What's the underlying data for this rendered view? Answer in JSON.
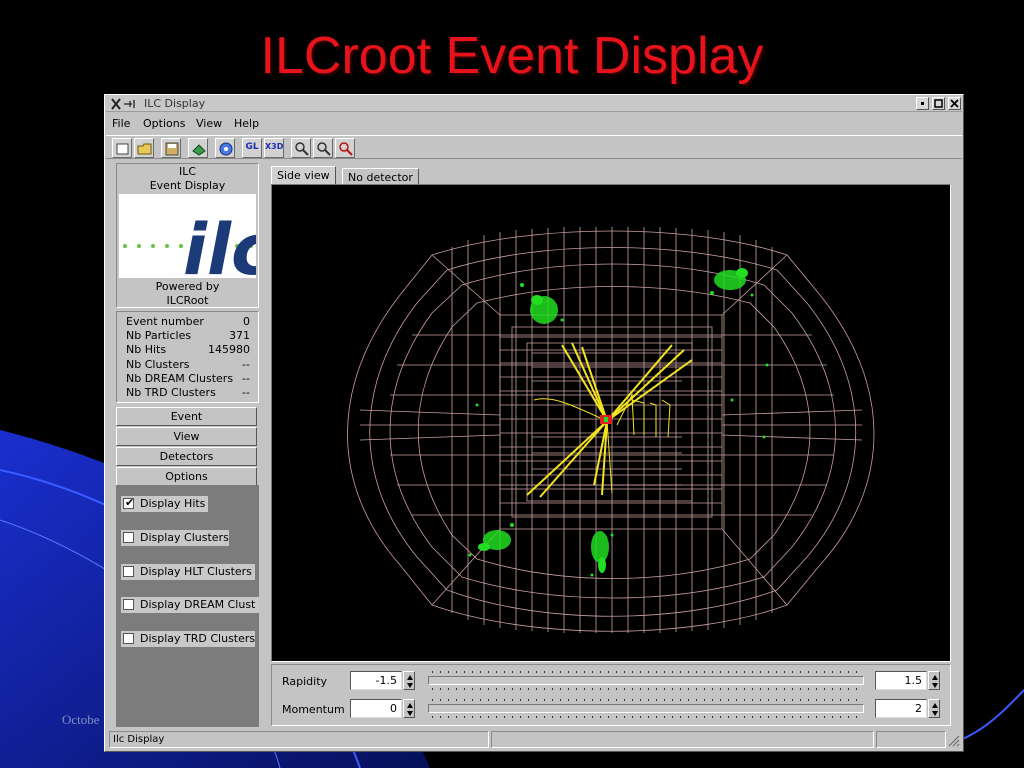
{
  "slide": {
    "title": "ILCroot Event Display",
    "footer_fragment": "Octobe"
  },
  "window": {
    "title": "ILC Display",
    "controls": [
      "minimize",
      "maximize",
      "close"
    ]
  },
  "menu": [
    "File",
    "Options",
    "View",
    "Help"
  ],
  "toolbar": {
    "buttons": [
      {
        "icon": "new-file-icon"
      },
      {
        "icon": "open-folder-icon"
      },
      {
        "icon": "save-icon"
      },
      {
        "icon": "print-icon"
      },
      {
        "icon": "info-icon"
      },
      {
        "icon": "gl-view-icon",
        "text": "GL"
      },
      {
        "icon": "x3d-view-icon",
        "text": "X3D"
      },
      {
        "icon": "zoom-in-icon"
      },
      {
        "icon": "zoom-out-icon"
      },
      {
        "icon": "zoom-reset-icon"
      }
    ]
  },
  "logo": {
    "line1": "ILC",
    "line2": "Event Display",
    "mark_text": "ilc",
    "powered_line1": "Powered by",
    "powered_line2": "ILCRoot"
  },
  "stats": [
    {
      "label": "Event number",
      "value": "0"
    },
    {
      "label": "Nb Particles",
      "value": "371"
    },
    {
      "label": "Nb Hits",
      "value": "145980"
    },
    {
      "label": "Nb Clusters",
      "value": "--"
    },
    {
      "label": "Nb DREAM Clusters",
      "value": "--"
    },
    {
      "label": "Nb TRD Clusters",
      "value": "--"
    }
  ],
  "nav_buttons": [
    "Event",
    "View",
    "Detectors",
    "Options"
  ],
  "options": [
    {
      "label": "Display Hits",
      "checked": true
    },
    {
      "label": "Display Clusters",
      "checked": false
    },
    {
      "label": "Display HLT Clusters",
      "checked": false
    },
    {
      "label": "Display DREAM Clust",
      "checked": false
    },
    {
      "label": "Display TRD Clusters",
      "checked": false
    }
  ],
  "tabs": [
    {
      "label": "Side view",
      "active": true
    },
    {
      "label": "No detector",
      "active": false
    }
  ],
  "controls": {
    "rapidity": {
      "label": "Rapidity",
      "min": "-1.5",
      "max": "1.5"
    },
    "momentum": {
      "label": "Momentum",
      "min": "0",
      "max": "2"
    }
  },
  "status": {
    "text": "Ilc Display"
  },
  "colors": {
    "slide_title": "#e8131a",
    "window_bg": "#c4c4c4",
    "viewport_bg": "#000000",
    "geometry": "#caa0a0",
    "hits": "#22dd22",
    "tracks": "#f2e41f"
  }
}
